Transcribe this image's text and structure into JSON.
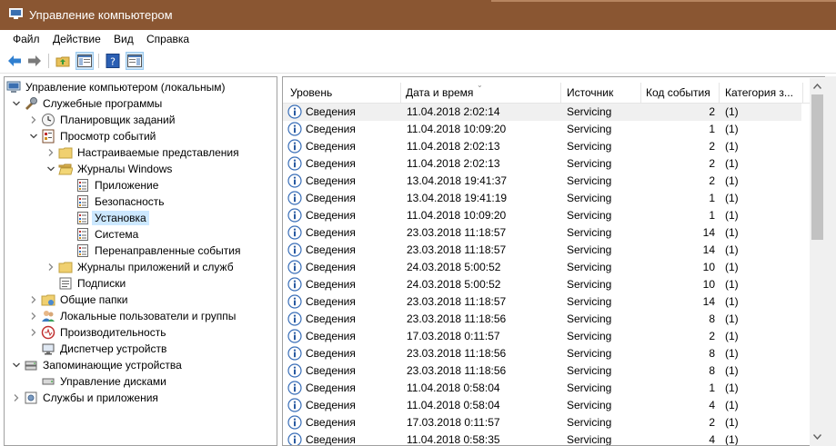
{
  "window": {
    "title": "Управление компьютером"
  },
  "menu": [
    "Файл",
    "Действие",
    "Вид",
    "Справка"
  ],
  "toolbar": {
    "buttons": [
      "back-arrow-icon",
      "forward-arrow-icon",
      "up-folder-icon",
      "show-tree-icon",
      "help-icon",
      "action-pane-icon"
    ]
  },
  "tree": [
    {
      "label": "Управление компьютером (локальным)",
      "level": 0,
      "expander": "",
      "icon": "computer-management-icon"
    },
    {
      "label": "Служебные программы",
      "level": 1,
      "expander": "open",
      "icon": "tools-icon"
    },
    {
      "label": "Планировщик заданий",
      "level": 2,
      "expander": "closed",
      "icon": "clock-icon"
    },
    {
      "label": "Просмотр событий",
      "level": 2,
      "expander": "open",
      "icon": "event-viewer-icon"
    },
    {
      "label": "Настраиваемые представления",
      "level": 3,
      "expander": "closed",
      "icon": "folder-icon"
    },
    {
      "label": "Журналы Windows",
      "level": 3,
      "expander": "open",
      "icon": "folder-open-icon"
    },
    {
      "label": "Приложение",
      "level": 4,
      "expander": "",
      "icon": "log-icon"
    },
    {
      "label": "Безопасность",
      "level": 4,
      "expander": "",
      "icon": "log-icon"
    },
    {
      "label": "Установка",
      "level": 4,
      "expander": "",
      "icon": "log-icon",
      "selected": true
    },
    {
      "label": "Система",
      "level": 4,
      "expander": "",
      "icon": "log-icon"
    },
    {
      "label": "Перенаправленные события",
      "level": 4,
      "expander": "",
      "icon": "log-icon"
    },
    {
      "label": "Журналы приложений и служб",
      "level": 3,
      "expander": "closed",
      "icon": "folder-icon"
    },
    {
      "label": "Подписки",
      "level": 3,
      "expander": "",
      "icon": "subscriptions-icon"
    },
    {
      "label": "Общие папки",
      "level": 2,
      "expander": "closed",
      "icon": "shared-folders-icon"
    },
    {
      "label": "Локальные пользователи и группы",
      "level": 2,
      "expander": "closed",
      "icon": "users-icon"
    },
    {
      "label": "Производительность",
      "level": 2,
      "expander": "closed",
      "icon": "performance-icon"
    },
    {
      "label": "Диспетчер устройств",
      "level": 2,
      "expander": "",
      "icon": "device-manager-icon"
    },
    {
      "label": "Запоминающие устройства",
      "level": 1,
      "expander": "open",
      "icon": "storage-icon"
    },
    {
      "label": "Управление дисками",
      "level": 2,
      "expander": "",
      "icon": "disk-icon"
    },
    {
      "label": "Службы и приложения",
      "level": 1,
      "expander": "closed",
      "icon": "services-icon"
    }
  ],
  "table": {
    "columns": [
      "Уровень",
      "Дата и время",
      "Источник",
      "Код события",
      "Категория з..."
    ],
    "rows": [
      [
        "Сведения",
        "11.04.2018 2:02:14",
        "Servicing",
        "2",
        "(1)"
      ],
      [
        "Сведения",
        "11.04.2018 10:09:20",
        "Servicing",
        "1",
        "(1)"
      ],
      [
        "Сведения",
        "11.04.2018 2:02:13",
        "Servicing",
        "2",
        "(1)"
      ],
      [
        "Сведения",
        "11.04.2018 2:02:13",
        "Servicing",
        "2",
        "(1)"
      ],
      [
        "Сведения",
        "13.04.2018 19:41:37",
        "Servicing",
        "2",
        "(1)"
      ],
      [
        "Сведения",
        "13.04.2018 19:41:19",
        "Servicing",
        "1",
        "(1)"
      ],
      [
        "Сведения",
        "11.04.2018 10:09:20",
        "Servicing",
        "1",
        "(1)"
      ],
      [
        "Сведения",
        "23.03.2018 11:18:57",
        "Servicing",
        "14",
        "(1)"
      ],
      [
        "Сведения",
        "23.03.2018 11:18:57",
        "Servicing",
        "14",
        "(1)"
      ],
      [
        "Сведения",
        "24.03.2018 5:00:52",
        "Servicing",
        "10",
        "(1)"
      ],
      [
        "Сведения",
        "24.03.2018 5:00:52",
        "Servicing",
        "10",
        "(1)"
      ],
      [
        "Сведения",
        "23.03.2018 11:18:57",
        "Servicing",
        "14",
        "(1)"
      ],
      [
        "Сведения",
        "23.03.2018 11:18:56",
        "Servicing",
        "8",
        "(1)"
      ],
      [
        "Сведения",
        "17.03.2018 0:11:57",
        "Servicing",
        "2",
        "(1)"
      ],
      [
        "Сведения",
        "23.03.2018 11:18:56",
        "Servicing",
        "8",
        "(1)"
      ],
      [
        "Сведения",
        "23.03.2018 11:18:56",
        "Servicing",
        "8",
        "(1)"
      ],
      [
        "Сведения",
        "11.04.2018 0:58:04",
        "Servicing",
        "1",
        "(1)"
      ],
      [
        "Сведения",
        "11.04.2018 0:58:04",
        "Servicing",
        "4",
        "(1)"
      ],
      [
        "Сведения",
        "17.03.2018 0:11:57",
        "Servicing",
        "2",
        "(1)"
      ],
      [
        "Сведения",
        "11.04.2018 0:58:35",
        "Servicing",
        "4",
        "(1)"
      ]
    ]
  }
}
